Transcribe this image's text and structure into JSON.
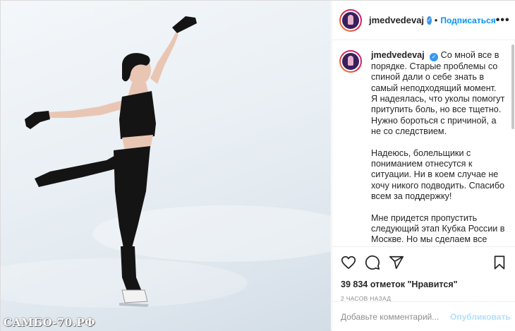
{
  "post": {
    "username": "jmedvedevaj",
    "follow_label": "Подписаться",
    "more_label": "•••",
    "caption": {
      "paragraphs": [
        "Со мной все в порядке. Старые проблемы со спиной дали о себе знать в самый неподходящий момент. Я надеялась, что уколы помогут притупить боль, но все тщетно. Нужно бороться с причиной, а не со следствием.",
        "Надеюсь, болельщики с пониманием отнесутся к ситуации. Ни в коем случае не хочу никого подводить. Спасибо всем за поддержку!",
        "Мне придется пропустить следующий этап Кубка России в Москве. Но мы сделаем все возможное, чтобы подготовиться к другим соревнованиям. Сезон еще"
      ]
    },
    "likes_text": "39 834 отметок \"Нравится\"",
    "time_text": "2 ЧАСОВ НАЗАД",
    "comment_placeholder": "Добавьте комментарий...",
    "publish_label": "Опубликовать"
  },
  "photo": {
    "watermark": "САМБО-70.РФ"
  },
  "icons": {
    "like": "heart-icon",
    "comment": "comment-icon",
    "share": "share-icon",
    "save": "bookmark-icon",
    "verified": "verified-icon"
  },
  "colors": {
    "accent": "#0095f6",
    "verified": "#3897f0",
    "muted": "#8e8e8e",
    "publish_disabled": "#b2dffc"
  }
}
